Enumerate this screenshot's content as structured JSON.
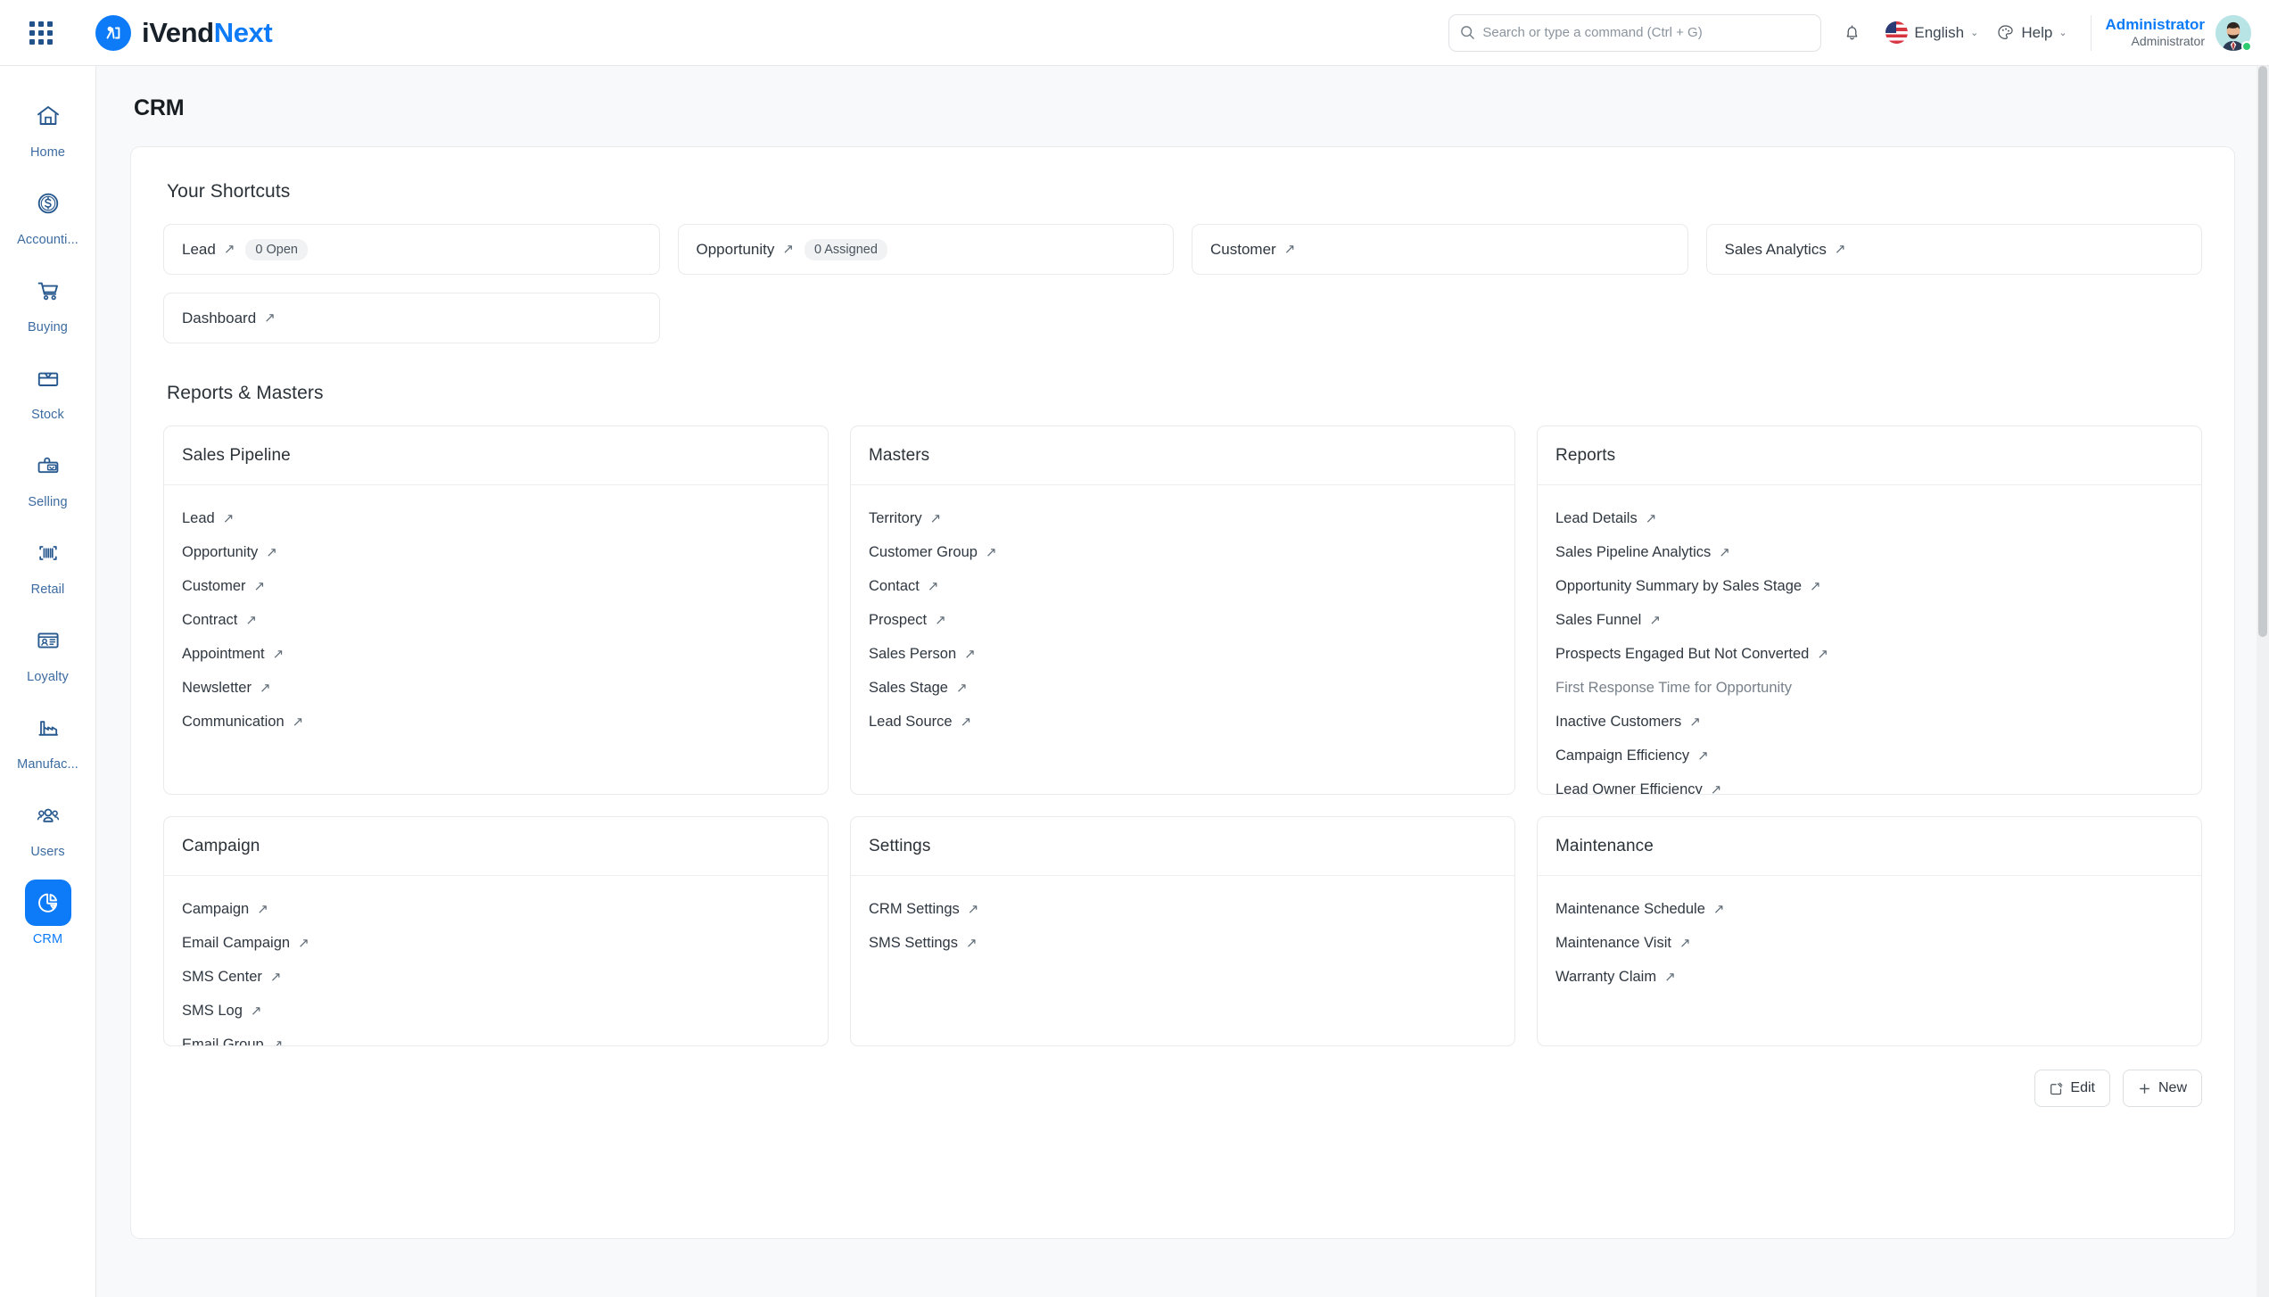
{
  "topbar": {
    "apps_icon": "grid-apps-icon",
    "brand": {
      "part1": "iVend",
      "part2": "Next",
      "logo_icon": "ivend-logo-icon"
    },
    "search": {
      "placeholder": "Search or type a command (Ctrl + G)",
      "value": "",
      "icon": "search-icon"
    },
    "notifications_icon": "bell-icon",
    "language": {
      "label": "English",
      "flag": "us-flag-icon",
      "caret": "⌄"
    },
    "help": {
      "label": "Help",
      "icon": "palette-icon",
      "caret": "⌄"
    },
    "user": {
      "name": "Administrator",
      "role": "Administrator",
      "avatar": "user-avatar",
      "status": "online"
    }
  },
  "sidebar": {
    "items": [
      {
        "label": "Home",
        "icon": "home-icon",
        "active": false
      },
      {
        "label": "Accounti...",
        "icon": "dollar-coin-icon",
        "active": false
      },
      {
        "label": "Buying",
        "icon": "shopping-cart-icon",
        "active": false
      },
      {
        "label": "Stock",
        "icon": "box-icon",
        "active": false
      },
      {
        "label": "Selling",
        "icon": "shopping-bag-icon",
        "active": false
      },
      {
        "label": "Retail",
        "icon": "barcode-icon",
        "active": false
      },
      {
        "label": "Loyalty",
        "icon": "id-card-icon",
        "active": false
      },
      {
        "label": "Manufac...",
        "icon": "factory-icon",
        "active": false
      },
      {
        "label": "Users",
        "icon": "users-icon",
        "active": false
      },
      {
        "label": "CRM",
        "icon": "pie-chart-icon",
        "active": true
      }
    ]
  },
  "page": {
    "title": "CRM",
    "shortcuts_title": "Your Shortcuts",
    "reports_masters_title": "Reports & Masters",
    "shortcuts": [
      {
        "label": "Lead",
        "arrow": "↗",
        "badge": "0 Open"
      },
      {
        "label": "Opportunity",
        "arrow": "↗",
        "badge": "0 Assigned"
      },
      {
        "label": "Customer",
        "arrow": "↗",
        "badge": ""
      },
      {
        "label": "Sales Analytics",
        "arrow": "↗",
        "badge": ""
      },
      {
        "label": "Dashboard",
        "arrow": "↗",
        "badge": ""
      }
    ],
    "panels_row1": [
      {
        "title": "Sales Pipeline",
        "links": [
          {
            "label": "Lead",
            "arrow": "↗"
          },
          {
            "label": "Opportunity",
            "arrow": "↗"
          },
          {
            "label": "Customer",
            "arrow": "↗"
          },
          {
            "label": "Contract",
            "arrow": "↗"
          },
          {
            "label": "Appointment",
            "arrow": "↗"
          },
          {
            "label": "Newsletter",
            "arrow": "↗"
          },
          {
            "label": "Communication",
            "arrow": "↗"
          }
        ]
      },
      {
        "title": "Masters",
        "links": [
          {
            "label": "Territory",
            "arrow": "↗"
          },
          {
            "label": "Customer Group",
            "arrow": "↗"
          },
          {
            "label": "Contact",
            "arrow": "↗"
          },
          {
            "label": "Prospect",
            "arrow": "↗"
          },
          {
            "label": "Sales Person",
            "arrow": "↗"
          },
          {
            "label": "Sales Stage",
            "arrow": "↗"
          },
          {
            "label": "Lead Source",
            "arrow": "↗"
          }
        ]
      },
      {
        "title": "Reports",
        "links": [
          {
            "label": "Lead Details",
            "arrow": "↗"
          },
          {
            "label": "Sales Pipeline Analytics",
            "arrow": "↗"
          },
          {
            "label": "Opportunity Summary by Sales Stage",
            "arrow": "↗"
          },
          {
            "label": "Sales Funnel",
            "arrow": "↗"
          },
          {
            "label": "Prospects Engaged But Not Converted",
            "arrow": "↗"
          },
          {
            "label": "First Response Time for Opportunity",
            "arrow": ""
          },
          {
            "label": "Inactive Customers",
            "arrow": "↗"
          },
          {
            "label": "Campaign Efficiency",
            "arrow": "↗"
          },
          {
            "label": "Lead Owner Efficiency",
            "arrow": "↗"
          }
        ]
      }
    ],
    "panels_row2": [
      {
        "title": "Campaign",
        "links": [
          {
            "label": "Campaign",
            "arrow": "↗"
          },
          {
            "label": "Email Campaign",
            "arrow": "↗"
          },
          {
            "label": "SMS Center",
            "arrow": "↗"
          },
          {
            "label": "SMS Log",
            "arrow": "↗"
          },
          {
            "label": "Email Group",
            "arrow": "↗"
          }
        ]
      },
      {
        "title": "Settings",
        "links": [
          {
            "label": "CRM Settings",
            "arrow": "↗"
          },
          {
            "label": "SMS Settings",
            "arrow": "↗"
          }
        ]
      },
      {
        "title": "Maintenance",
        "links": [
          {
            "label": "Maintenance Schedule",
            "arrow": "↗"
          },
          {
            "label": "Maintenance Visit",
            "arrow": "↗"
          },
          {
            "label": "Warranty Claim",
            "arrow": "↗"
          }
        ]
      }
    ],
    "footer": {
      "edit_label": "Edit",
      "edit_icon": "edit-square-icon",
      "new_label": "New",
      "new_icon": "plus-icon"
    }
  },
  "colors": {
    "accent": "#0d7bf7",
    "sidebar_label": "#3c6ba1",
    "page_bg": "#f8f9fa",
    "card_border": "#e8eaec",
    "online": "#2ecc71"
  }
}
